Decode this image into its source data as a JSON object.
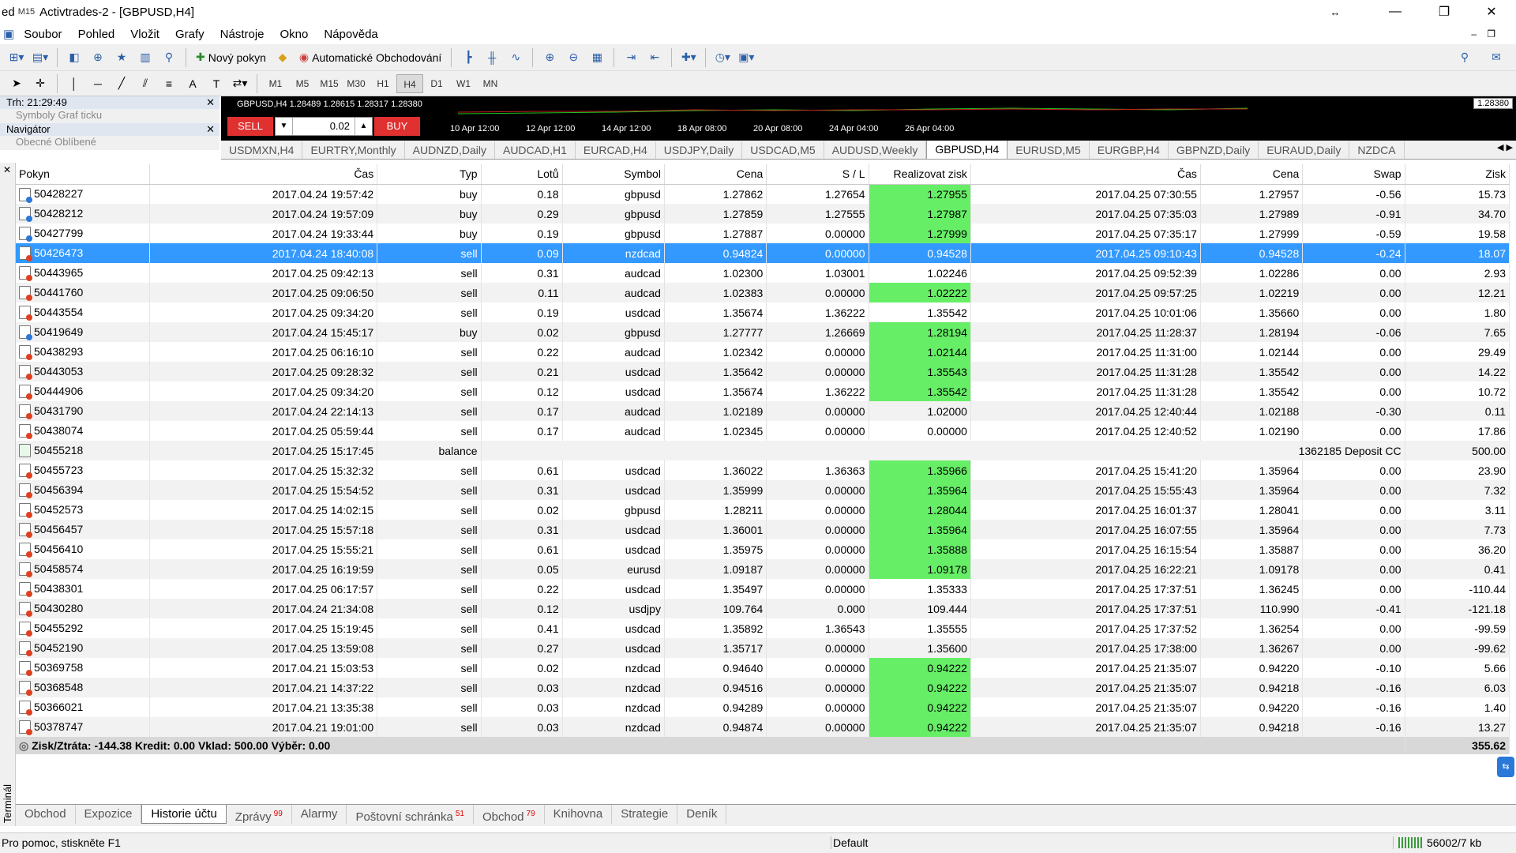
{
  "window": {
    "title": "Activtrades-2 - [GBPUSD,H4]",
    "prefix": "ed",
    "timeframe_badge": "M15"
  },
  "menu": [
    "Soubor",
    "Pohled",
    "Vložit",
    "Grafy",
    "Nástroje",
    "Okno",
    "Nápověda"
  ],
  "toolbar": {
    "new_order": "Nový pokyn",
    "auto_trading": "Automatické Obchodování"
  },
  "timeframes": [
    "M1",
    "M5",
    "M15",
    "M30",
    "H1",
    "H4",
    "D1",
    "W1",
    "MN"
  ],
  "active_timeframe": "H4",
  "market_watch": {
    "label": "Trh: 21:29:49",
    "tabs": "Symboly   Graf ticku"
  },
  "navigator": {
    "label": "Navigátor",
    "tabs": "Obecné      Oblíbené"
  },
  "chart": {
    "header": "GBPUSD,H4  1.28489 1.28615 1.28317 1.28380",
    "sell": "SELL",
    "buy": "BUY",
    "lot": "0.02",
    "price": "1.28380",
    "dates": [
      "10 Apr 12:00",
      "12 Apr 12:00",
      "14 Apr 12:00",
      "18 Apr 08:00",
      "20 Apr 08:00",
      "24 Apr 04:00",
      "26 Apr 04:00"
    ]
  },
  "chart_tabs": [
    "USDMXN,H4",
    "EURTRY,Monthly",
    "AUDNZD,Daily",
    "AUDCAD,H1",
    "EURCAD,H4",
    "USDJPY,Daily",
    "USDCAD,M5",
    "AUDUSD,Weekly",
    "GBPUSD,H4",
    "EURUSD,M5",
    "EURGBP,H4",
    "GBPNZD,Daily",
    "EURAUD,Daily",
    "NZDCA"
  ],
  "active_chart_tab": "GBPUSD,H4",
  "columns": [
    "Pokyn",
    "Čas",
    "Typ",
    "Lotů",
    "Symbol",
    "Cena",
    "S / L",
    "Realizovat zisk",
    "Čas",
    "Cena",
    "Swap",
    "Zisk"
  ],
  "rows": [
    {
      "id": "50428227",
      "open": "2017.04.24 19:57:42",
      "type": "buy",
      "lots": "0.18",
      "sym": "gbpusd",
      "price": "1.27862",
      "sl": "1.27654",
      "tp": "1.27955",
      "close": "2017.04.25 07:30:55",
      "cprice": "1.27957",
      "swap": "-0.56",
      "profit": "15.73",
      "hl": true,
      "icon": "b"
    },
    {
      "id": "50428212",
      "open": "2017.04.24 19:57:09",
      "type": "buy",
      "lots": "0.29",
      "sym": "gbpusd",
      "price": "1.27859",
      "sl": "1.27555",
      "tp": "1.27987",
      "close": "2017.04.25 07:35:03",
      "cprice": "1.27989",
      "swap": "-0.91",
      "profit": "34.70",
      "hl": true,
      "icon": "b"
    },
    {
      "id": "50427799",
      "open": "2017.04.24 19:33:44",
      "type": "buy",
      "lots": "0.19",
      "sym": "gbpusd",
      "price": "1.27887",
      "sl": "0.00000",
      "tp": "1.27999",
      "close": "2017.04.25 07:35:17",
      "cprice": "1.27999",
      "swap": "-0.59",
      "profit": "19.58",
      "hl": true,
      "icon": "b"
    },
    {
      "id": "50426473",
      "open": "2017.04.24 18:40:08",
      "type": "sell",
      "lots": "0.09",
      "sym": "nzdcad",
      "price": "0.94824",
      "sl": "0.00000",
      "tp": "0.94528",
      "close": "2017.04.25 09:10:43",
      "cprice": "0.94528",
      "swap": "-0.24",
      "profit": "18.07",
      "hl": true,
      "icon": "r",
      "sel": true
    },
    {
      "id": "50443965",
      "open": "2017.04.25 09:42:13",
      "type": "sell",
      "lots": "0.31",
      "sym": "audcad",
      "price": "1.02300",
      "sl": "1.03001",
      "tp": "1.02246",
      "close": "2017.04.25 09:52:39",
      "cprice": "1.02286",
      "swap": "0.00",
      "profit": "2.93",
      "hl": false,
      "icon": "r"
    },
    {
      "id": "50441760",
      "open": "2017.04.25 09:06:50",
      "type": "sell",
      "lots": "0.11",
      "sym": "audcad",
      "price": "1.02383",
      "sl": "0.00000",
      "tp": "1.02222",
      "close": "2017.04.25 09:57:25",
      "cprice": "1.02219",
      "swap": "0.00",
      "profit": "12.21",
      "hl": true,
      "icon": "r"
    },
    {
      "id": "50443554",
      "open": "2017.04.25 09:34:20",
      "type": "sell",
      "lots": "0.19",
      "sym": "usdcad",
      "price": "1.35674",
      "sl": "1.36222",
      "tp": "1.35542",
      "close": "2017.04.25 10:01:06",
      "cprice": "1.35660",
      "swap": "0.00",
      "profit": "1.80",
      "hl": false,
      "icon": "r"
    },
    {
      "id": "50419649",
      "open": "2017.04.24 15:45:17",
      "type": "buy",
      "lots": "0.02",
      "sym": "gbpusd",
      "price": "1.27777",
      "sl": "1.26669",
      "tp": "1.28194",
      "close": "2017.04.25 11:28:37",
      "cprice": "1.28194",
      "swap": "-0.06",
      "profit": "7.65",
      "hl": true,
      "icon": "b"
    },
    {
      "id": "50438293",
      "open": "2017.04.25 06:16:10",
      "type": "sell",
      "lots": "0.22",
      "sym": "audcad",
      "price": "1.02342",
      "sl": "0.00000",
      "tp": "1.02144",
      "close": "2017.04.25 11:31:00",
      "cprice": "1.02144",
      "swap": "0.00",
      "profit": "29.49",
      "hl": true,
      "icon": "r"
    },
    {
      "id": "50443053",
      "open": "2017.04.25 09:28:32",
      "type": "sell",
      "lots": "0.21",
      "sym": "usdcad",
      "price": "1.35642",
      "sl": "0.00000",
      "tp": "1.35543",
      "close": "2017.04.25 11:31:28",
      "cprice": "1.35542",
      "swap": "0.00",
      "profit": "14.22",
      "hl": true,
      "icon": "r"
    },
    {
      "id": "50444906",
      "open": "2017.04.25 09:34:20",
      "type": "sell",
      "lots": "0.12",
      "sym": "usdcad",
      "price": "1.35674",
      "sl": "1.36222",
      "tp": "1.35542",
      "close": "2017.04.25 11:31:28",
      "cprice": "1.35542",
      "swap": "0.00",
      "profit": "10.72",
      "hl": true,
      "icon": "r"
    },
    {
      "id": "50431790",
      "open": "2017.04.24 22:14:13",
      "type": "sell",
      "lots": "0.17",
      "sym": "audcad",
      "price": "1.02189",
      "sl": "0.00000",
      "tp": "1.02000",
      "close": "2017.04.25 12:40:44",
      "cprice": "1.02188",
      "swap": "-0.30",
      "profit": "0.11",
      "hl": false,
      "icon": "r"
    },
    {
      "id": "50438074",
      "open": "2017.04.25 05:59:44",
      "type": "sell",
      "lots": "0.17",
      "sym": "audcad",
      "price": "1.02345",
      "sl": "0.00000",
      "tp": "0.00000",
      "close": "2017.04.25 12:40:52",
      "cprice": "1.02190",
      "swap": "0.00",
      "profit": "17.86",
      "hl": false,
      "icon": "r"
    },
    {
      "id": "50455218",
      "open": "2017.04.25 15:17:45",
      "type": "balance",
      "lots": "",
      "sym": "",
      "price": "",
      "sl": "",
      "tp": "",
      "close": "",
      "cprice": "1362185 Deposit CC",
      "swap": "",
      "profit": "500.00",
      "hl": false,
      "icon": "g",
      "span": true
    },
    {
      "id": "50455723",
      "open": "2017.04.25 15:32:32",
      "type": "sell",
      "lots": "0.61",
      "sym": "usdcad",
      "price": "1.36022",
      "sl": "1.36363",
      "tp": "1.35966",
      "close": "2017.04.25 15:41:20",
      "cprice": "1.35964",
      "swap": "0.00",
      "profit": "23.90",
      "hl": true,
      "icon": "r"
    },
    {
      "id": "50456394",
      "open": "2017.04.25 15:54:52",
      "type": "sell",
      "lots": "0.31",
      "sym": "usdcad",
      "price": "1.35999",
      "sl": "0.00000",
      "tp": "1.35964",
      "close": "2017.04.25 15:55:43",
      "cprice": "1.35964",
      "swap": "0.00",
      "profit": "7.32",
      "hl": true,
      "icon": "r"
    },
    {
      "id": "50452573",
      "open": "2017.04.25 14:02:15",
      "type": "sell",
      "lots": "0.02",
      "sym": "gbpusd",
      "price": "1.28211",
      "sl": "0.00000",
      "tp": "1.28044",
      "close": "2017.04.25 16:01:37",
      "cprice": "1.28041",
      "swap": "0.00",
      "profit": "3.11",
      "hl": true,
      "icon": "r"
    },
    {
      "id": "50456457",
      "open": "2017.04.25 15:57:18",
      "type": "sell",
      "lots": "0.31",
      "sym": "usdcad",
      "price": "1.36001",
      "sl": "0.00000",
      "tp": "1.35964",
      "close": "2017.04.25 16:07:55",
      "cprice": "1.35964",
      "swap": "0.00",
      "profit": "7.73",
      "hl": true,
      "icon": "r"
    },
    {
      "id": "50456410",
      "open": "2017.04.25 15:55:21",
      "type": "sell",
      "lots": "0.61",
      "sym": "usdcad",
      "price": "1.35975",
      "sl": "0.00000",
      "tp": "1.35888",
      "close": "2017.04.25 16:15:54",
      "cprice": "1.35887",
      "swap": "0.00",
      "profit": "36.20",
      "hl": true,
      "icon": "r"
    },
    {
      "id": "50458574",
      "open": "2017.04.25 16:19:59",
      "type": "sell",
      "lots": "0.05",
      "sym": "eurusd",
      "price": "1.09187",
      "sl": "0.00000",
      "tp": "1.09178",
      "close": "2017.04.25 16:22:21",
      "cprice": "1.09178",
      "swap": "0.00",
      "profit": "0.41",
      "hl": true,
      "icon": "r"
    },
    {
      "id": "50438301",
      "open": "2017.04.25 06:17:57",
      "type": "sell",
      "lots": "0.22",
      "sym": "usdcad",
      "price": "1.35497",
      "sl": "0.00000",
      "tp": "1.35333",
      "close": "2017.04.25 17:37:51",
      "cprice": "1.36245",
      "swap": "0.00",
      "profit": "-110.44",
      "hl": false,
      "icon": "r"
    },
    {
      "id": "50430280",
      "open": "2017.04.24 21:34:08",
      "type": "sell",
      "lots": "0.12",
      "sym": "usdjpy",
      "price": "109.764",
      "sl": "0.000",
      "tp": "109.444",
      "close": "2017.04.25 17:37:51",
      "cprice": "110.990",
      "swap": "-0.41",
      "profit": "-121.18",
      "hl": false,
      "icon": "r"
    },
    {
      "id": "50455292",
      "open": "2017.04.25 15:19:45",
      "type": "sell",
      "lots": "0.41",
      "sym": "usdcad",
      "price": "1.35892",
      "sl": "1.36543",
      "tp": "1.35555",
      "close": "2017.04.25 17:37:52",
      "cprice": "1.36254",
      "swap": "0.00",
      "profit": "-99.59",
      "hl": false,
      "icon": "r"
    },
    {
      "id": "50452190",
      "open": "2017.04.25 13:59:08",
      "type": "sell",
      "lots": "0.27",
      "sym": "usdcad",
      "price": "1.35717",
      "sl": "0.00000",
      "tp": "1.35600",
      "close": "2017.04.25 17:38:00",
      "cprice": "1.36267",
      "swap": "0.00",
      "profit": "-99.62",
      "hl": false,
      "icon": "r"
    },
    {
      "id": "50369758",
      "open": "2017.04.21 15:03:53",
      "type": "sell",
      "lots": "0.02",
      "sym": "nzdcad",
      "price": "0.94640",
      "sl": "0.00000",
      "tp": "0.94222",
      "close": "2017.04.25 21:35:07",
      "cprice": "0.94220",
      "swap": "-0.10",
      "profit": "5.66",
      "hl": true,
      "icon": "r"
    },
    {
      "id": "50368548",
      "open": "2017.04.21 14:37:22",
      "type": "sell",
      "lots": "0.03",
      "sym": "nzdcad",
      "price": "0.94516",
      "sl": "0.00000",
      "tp": "0.94222",
      "close": "2017.04.25 21:35:07",
      "cprice": "0.94218",
      "swap": "-0.16",
      "profit": "6.03",
      "hl": true,
      "icon": "r"
    },
    {
      "id": "50366021",
      "open": "2017.04.21 13:35:38",
      "type": "sell",
      "lots": "0.03",
      "sym": "nzdcad",
      "price": "0.94289",
      "sl": "0.00000",
      "tp": "0.94222",
      "close": "2017.04.25 21:35:07",
      "cprice": "0.94220",
      "swap": "-0.16",
      "profit": "1.40",
      "hl": true,
      "icon": "r"
    },
    {
      "id": "50378747",
      "open": "2017.04.21 19:01:00",
      "type": "sell",
      "lots": "0.03",
      "sym": "nzdcad",
      "price": "0.94874",
      "sl": "0.00000",
      "tp": "0.94222",
      "close": "2017.04.25 21:35:07",
      "cprice": "0.94218",
      "swap": "-0.16",
      "profit": "13.27",
      "hl": true,
      "icon": "r"
    }
  ],
  "total": {
    "summary": "Zisk/Ztráta: -144.38  Kredit: 0.00  Vklad: 500.00  Výběr: 0.00",
    "profit": "355.62"
  },
  "bottom_tabs": [
    {
      "label": "Obchod",
      "badge": ""
    },
    {
      "label": "Expozice",
      "badge": ""
    },
    {
      "label": "Historie účtu",
      "badge": ""
    },
    {
      "label": "Zprávy",
      "badge": "99"
    },
    {
      "label": "Alarmy",
      "badge": ""
    },
    {
      "label": "Poštovní schránka",
      "badge": "51"
    },
    {
      "label": "Obchod",
      "badge": "79"
    },
    {
      "label": "Knihovna",
      "badge": ""
    },
    {
      "label": "Strategie",
      "badge": ""
    },
    {
      "label": "Deník",
      "badge": ""
    }
  ],
  "active_bottom_tab": 2,
  "terminal_label": "Terminál",
  "status": {
    "help": "Pro pomoc, stiskněte F1",
    "profile": "Default",
    "traffic": "56002/7 kb"
  }
}
